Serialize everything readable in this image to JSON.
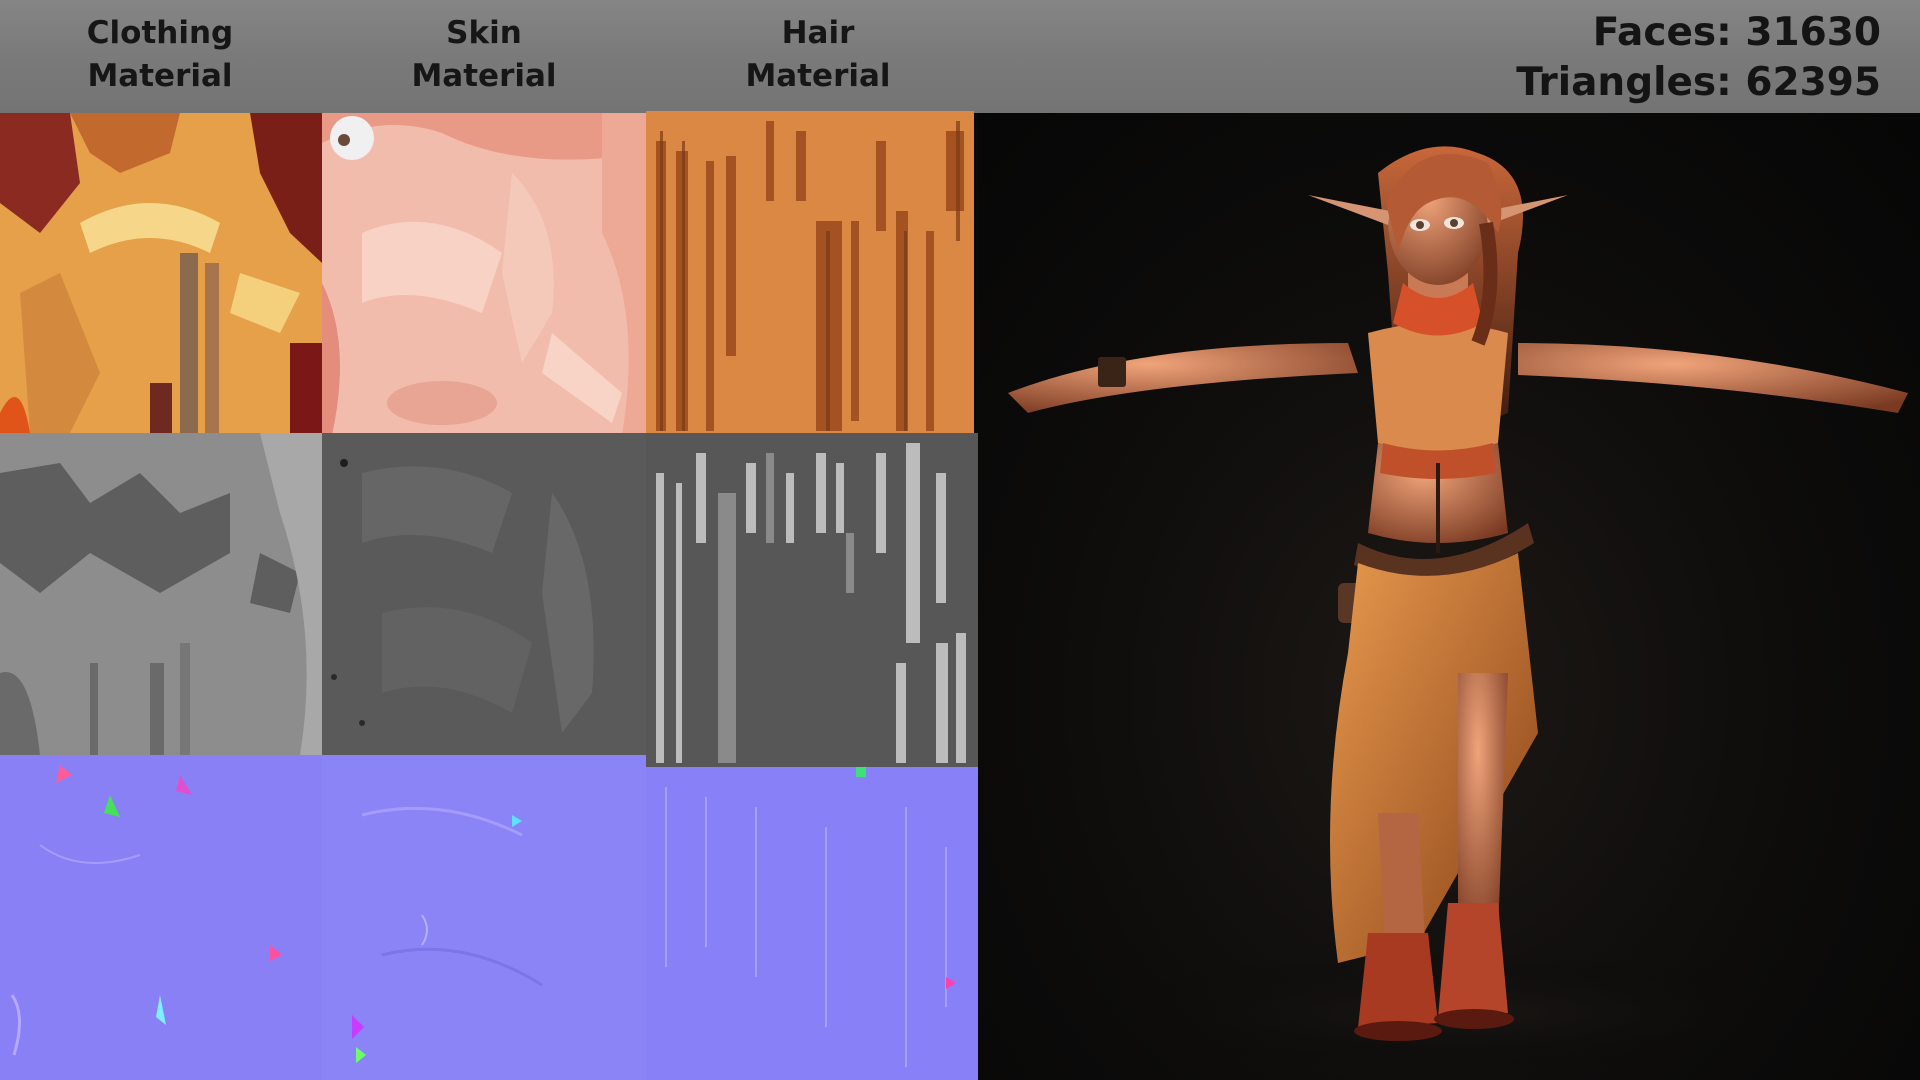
{
  "header": {
    "columns": [
      {
        "line1": "Clothing",
        "line2": "Material"
      },
      {
        "line1": "Skin",
        "line2": "Material"
      },
      {
        "line1": "Hair",
        "line2": "Material"
      }
    ],
    "stats": {
      "faces": "Faces: 31630",
      "triangles": "Triangles: 62395"
    }
  },
  "palette": {
    "clothing_albedo": "#e8a24a",
    "skin_albedo": "#f3c2b2",
    "hair_albedo": "#d98543",
    "roughness_gray": "#8c8c8c",
    "dark_gray": "#5b5b5b",
    "normal_blue": "#8a80f7"
  }
}
